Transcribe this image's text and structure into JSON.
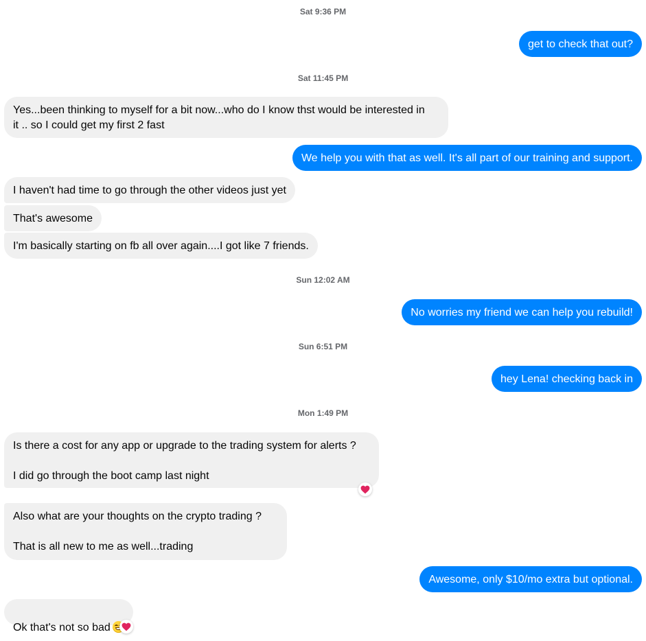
{
  "conversation": {
    "timestamps": [
      "Sat 9:36 PM",
      "Sat 11:45 PM",
      "Sun 12:02 AM",
      "Sun 6:51 PM",
      "Mon 1:49 PM"
    ],
    "messages": [
      {
        "sender": "me",
        "text": "get to check that out?"
      },
      {
        "sender": "them",
        "text": "Yes...been thinking to myself for a bit now...who do I know thst would be interested in\nit .. so I could get my first 2 fast"
      },
      {
        "sender": "me",
        "text": "We help you with that as well. It's all part of our training and support."
      },
      {
        "sender": "them",
        "text": "I haven't had time to go through the other videos just yet"
      },
      {
        "sender": "them",
        "text": "That's awesome"
      },
      {
        "sender": "them",
        "text": "I'm basically starting on fb all over again....I got like 7 friends."
      },
      {
        "sender": "me",
        "text": "No worries my friend we can help you rebuild!"
      },
      {
        "sender": "me",
        "text": "hey Lena!  checking back in"
      },
      {
        "sender": "them",
        "text": "Is there a cost for any app or upgrade to the trading system for alerts ?\n\nI did go through the boot camp last night",
        "reaction": "heart"
      },
      {
        "sender": "them",
        "text": "Also what are your thoughts on the crypto trading ?\n\nThat is all new to me as well...trading"
      },
      {
        "sender": "me",
        "text": "Awesome, only $10/mo extra but optional."
      },
      {
        "sender": "them",
        "text": "Ok that's not so bad",
        "emoji": "grinning-face",
        "reaction": "heart"
      }
    ]
  },
  "colors": {
    "outgoing_bubble": "#0084ff",
    "incoming_bubble": "#f0f0f0",
    "timestamp": "#65676b",
    "reaction_heart": "#e0245e"
  }
}
